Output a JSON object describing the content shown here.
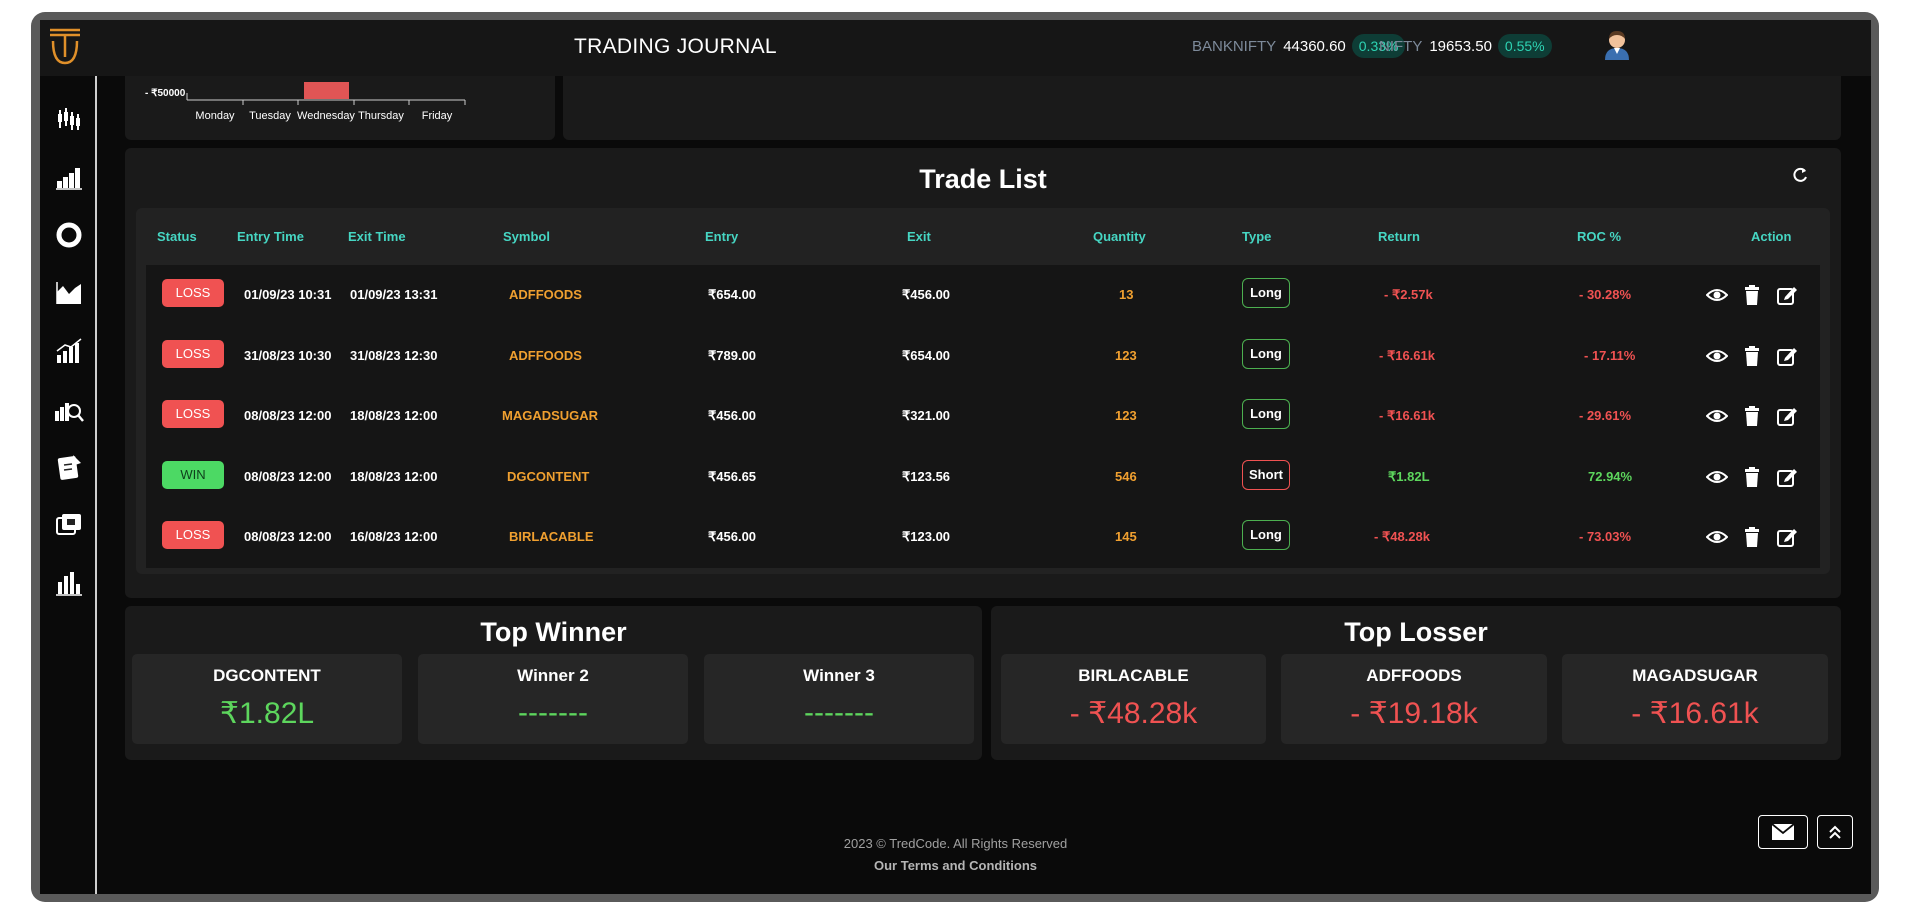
{
  "header": {
    "title": "TRADING JOURNAL",
    "tickers": [
      {
        "name": "BANKNIFTY",
        "value": "44360.60",
        "change": "0.33%"
      },
      {
        "name": "NIFTY",
        "value": "19653.50",
        "change": "0.55%"
      }
    ]
  },
  "sidebar": {
    "items": [
      "candlestick-icon",
      "bar-chart-icon",
      "donut-icon",
      "area-chart-icon",
      "growth-chart-icon",
      "analytics-search-icon",
      "notes-icon",
      "media-icon",
      "stats-icon"
    ]
  },
  "weekly_chart": {
    "y_tick": "- ₹50000",
    "days": [
      "Monday",
      "Tuesday",
      "Wednesday",
      "Thursday",
      "Friday"
    ],
    "bar_color": "#e05555"
  },
  "trade_list": {
    "title": "Trade List",
    "columns": [
      "Status",
      "Entry Time",
      "Exit Time",
      "Symbol",
      "Entry",
      "Exit",
      "Quantity",
      "Type",
      "Return",
      "ROC %",
      "Action"
    ],
    "rows": [
      {
        "status": "LOSS",
        "entry_time": "01/09/23 10:31",
        "exit_time": "01/09/23 13:31",
        "symbol": "ADFFOODS",
        "entry": "₹654.00",
        "exit": "₹456.00",
        "quantity": "13",
        "type": "Long",
        "return": "- ₹2.57k",
        "roc": "- 30.28%"
      },
      {
        "status": "LOSS",
        "entry_time": "31/08/23 10:30",
        "exit_time": "31/08/23 12:30",
        "symbol": "ADFFOODS",
        "entry": "₹789.00",
        "exit": "₹654.00",
        "quantity": "123",
        "type": "Long",
        "return": "- ₹16.61k",
        "roc": "- 17.11%"
      },
      {
        "status": "LOSS",
        "entry_time": "08/08/23 12:00",
        "exit_time": "18/08/23 12:00",
        "symbol": "MAGADSUGAR",
        "entry": "₹456.00",
        "exit": "₹321.00",
        "quantity": "123",
        "type": "Long",
        "return": "- ₹16.61k",
        "roc": "- 29.61%"
      },
      {
        "status": "WIN",
        "entry_time": "08/08/23 12:00",
        "exit_time": "18/08/23 12:00",
        "symbol": "DGCONTENT",
        "entry": "₹456.65",
        "exit": "₹123.56",
        "quantity": "546",
        "type": "Short",
        "return": "₹1.82L",
        "roc": "72.94%"
      },
      {
        "status": "LOSS",
        "entry_time": "08/08/23 12:00",
        "exit_time": "16/08/23 12:00",
        "symbol": "BIRLACABLE",
        "entry": "₹456.00",
        "exit": "₹123.00",
        "quantity": "145",
        "type": "Long",
        "return": "- ₹48.28k",
        "roc": "- 73.03%"
      }
    ]
  },
  "top_winner": {
    "title": "Top Winner",
    "items": [
      {
        "name": "DGCONTENT",
        "value": "₹1.82L"
      },
      {
        "name": "Winner 2",
        "value": "-------"
      },
      {
        "name": "Winner 3",
        "value": "-------"
      }
    ]
  },
  "top_loser": {
    "title": "Top Losser",
    "items": [
      {
        "name": "BIRLACABLE",
        "value": "- ₹48.28k"
      },
      {
        "name": "ADFFOODS",
        "value": "- ₹19.18k"
      },
      {
        "name": "MAGADSUGAR",
        "value": "- ₹16.61k"
      }
    ]
  },
  "footer": {
    "copyright": "2023 © TredCode. All Rights Reserved",
    "terms": "Our Terms and Conditions"
  },
  "colors": {
    "accent_teal": "#46d6c3",
    "loss_red": "#f05252",
    "win_green": "#5dd65d",
    "symbol_orange": "#f0a030"
  }
}
